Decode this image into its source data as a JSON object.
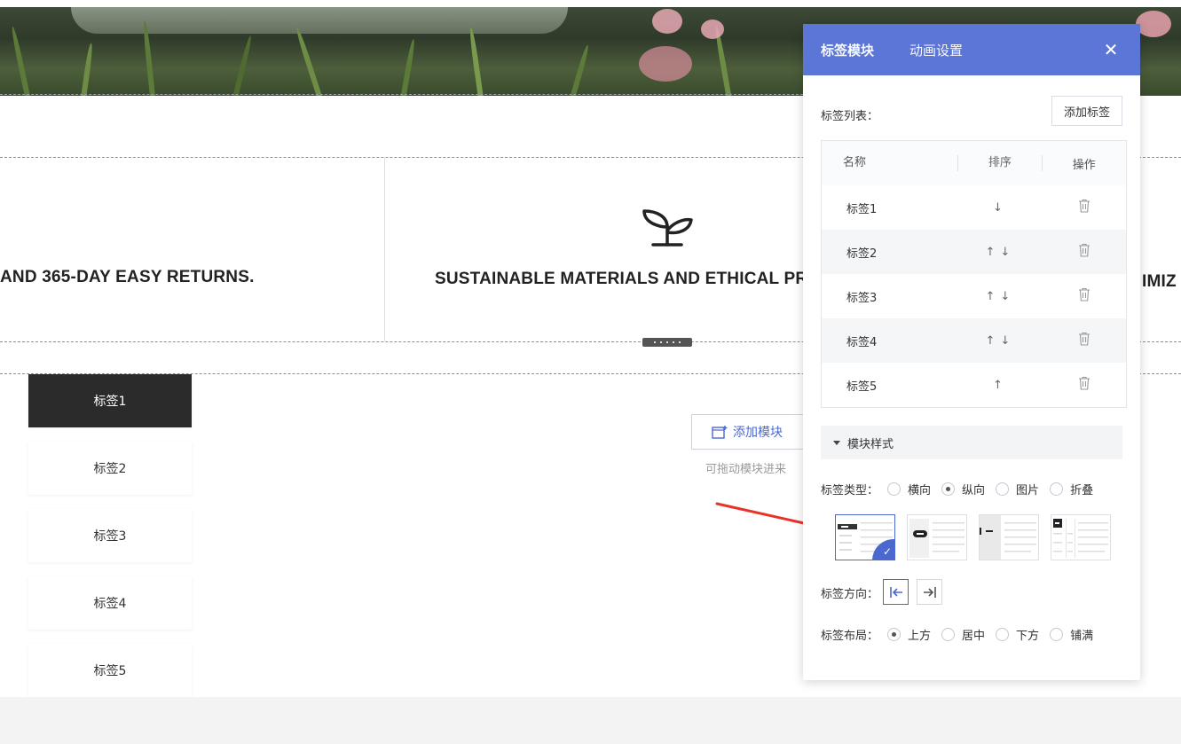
{
  "features": {
    "left_text": "AND 365-DAY EASY RETURNS.",
    "middle_text": "SUSTAINABLE MATERIALS AND ETHICAL PRAC",
    "right_text": "IMIZ"
  },
  "tabs": [
    "标签1",
    "标签2",
    "标签3",
    "标签4",
    "标签5"
  ],
  "add_module": {
    "label": "添加模块",
    "hint": "可拖动模块进来"
  },
  "panel": {
    "tabs": [
      "标签模块",
      "动画设置"
    ],
    "list_label": "标签列表：",
    "add_tag_button": "添加标签",
    "table": {
      "headers": {
        "name": "名称",
        "sort": "排序",
        "op": "操作"
      },
      "rows": [
        {
          "name": "标签1",
          "sort": "↓"
        },
        {
          "name": "标签2",
          "sort": "↑↓"
        },
        {
          "name": "标签3",
          "sort": "↑↓"
        },
        {
          "name": "标签4",
          "sort": "↑↓"
        },
        {
          "name": "标签5",
          "sort": "↑"
        }
      ]
    },
    "section_title": "模块样式",
    "tag_type": {
      "label": "标签类型：",
      "options": [
        "横向",
        "纵向",
        "图片",
        "折叠"
      ],
      "selected": "纵向"
    },
    "tag_direction": {
      "label": "标签方向："
    },
    "tag_layout": {
      "label": "标签布局：",
      "options": [
        "上方",
        "居中",
        "下方",
        "铺满"
      ],
      "selected": "上方"
    }
  },
  "colors": {
    "accent": "#5b76d6",
    "active_tab": "#2b2b2b",
    "pointer": "#e8332a"
  }
}
